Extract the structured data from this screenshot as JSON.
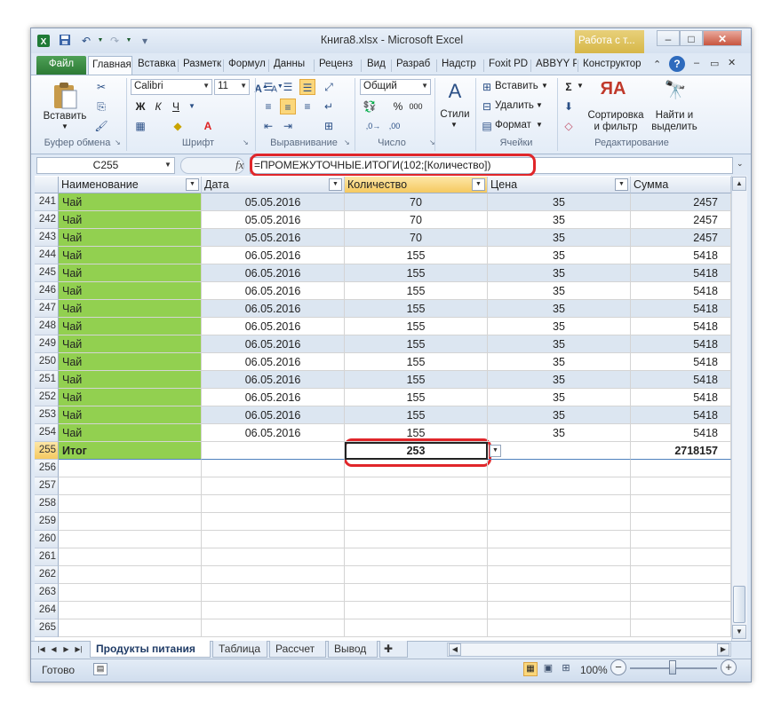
{
  "titlebar": {
    "title": "Книга8.xlsx - Microsoft Excel",
    "context_tab": "Работа с т...",
    "qat": [
      "excel-icon",
      "save-icon",
      "undo-icon",
      "redo-icon"
    ]
  },
  "ribbon_tabs": [
    {
      "label": "Файл",
      "kind": "file"
    },
    {
      "label": "Главная",
      "kind": "active"
    },
    {
      "label": "Вставка"
    },
    {
      "label": "Разметк"
    },
    {
      "label": "Формул"
    },
    {
      "label": "Данны"
    },
    {
      "label": "Реценз"
    },
    {
      "label": "Вид"
    },
    {
      "label": "Разраб"
    },
    {
      "label": "Надстр"
    },
    {
      "label": "Foxit PD"
    },
    {
      "label": "ABBYY P"
    },
    {
      "label": "Конструктор"
    }
  ],
  "ribbon": {
    "clipboard": {
      "paste": "Вставить",
      "group": "Буфер обмена"
    },
    "font": {
      "name": "Calibri",
      "size": "11",
      "bold": "Ж",
      "italic": "К",
      "underline": "Ч",
      "group": "Шрифт"
    },
    "alignment": {
      "group": "Выравнивание"
    },
    "number": {
      "format": "Общий",
      "percent": "%",
      "thousands": "000",
      "group": "Число"
    },
    "styles": {
      "label": "Стили"
    },
    "cells": {
      "insert": "Вставить",
      "delete": "Удалить",
      "format": "Формат",
      "group": "Ячейки"
    },
    "editing": {
      "sigma": "Σ",
      "sort_line1": "Сортировка",
      "sort_line2": "и фильтр",
      "find_line1": "Найти и",
      "find_line2": "выделить",
      "group": "Редактирование"
    }
  },
  "formula_bar": {
    "name_box": "C255",
    "fx": "fx",
    "formula": "=ПРОМЕЖУТОЧНЫЕ.ИТОГИ(102;[Количество])"
  },
  "columns": [
    "Наименование",
    "Дата",
    "Количество",
    "Цена",
    "Сумма"
  ],
  "rows": [
    {
      "num": "241",
      "name": "Чай",
      "date": "05.05.2016",
      "qty": "70",
      "price": "35",
      "sum": "2457"
    },
    {
      "num": "242",
      "name": "Чай",
      "date": "05.05.2016",
      "qty": "70",
      "price": "35",
      "sum": "2457"
    },
    {
      "num": "243",
      "name": "Чай",
      "date": "05.05.2016",
      "qty": "70",
      "price": "35",
      "sum": "2457"
    },
    {
      "num": "244",
      "name": "Чай",
      "date": "06.05.2016",
      "qty": "155",
      "price": "35",
      "sum": "5418"
    },
    {
      "num": "245",
      "name": "Чай",
      "date": "06.05.2016",
      "qty": "155",
      "price": "35",
      "sum": "5418"
    },
    {
      "num": "246",
      "name": "Чай",
      "date": "06.05.2016",
      "qty": "155",
      "price": "35",
      "sum": "5418"
    },
    {
      "num": "247",
      "name": "Чай",
      "date": "06.05.2016",
      "qty": "155",
      "price": "35",
      "sum": "5418"
    },
    {
      "num": "248",
      "name": "Чай",
      "date": "06.05.2016",
      "qty": "155",
      "price": "35",
      "sum": "5418"
    },
    {
      "num": "249",
      "name": "Чай",
      "date": "06.05.2016",
      "qty": "155",
      "price": "35",
      "sum": "5418"
    },
    {
      "num": "250",
      "name": "Чай",
      "date": "06.05.2016",
      "qty": "155",
      "price": "35",
      "sum": "5418"
    },
    {
      "num": "251",
      "name": "Чай",
      "date": "06.05.2016",
      "qty": "155",
      "price": "35",
      "sum": "5418"
    },
    {
      "num": "252",
      "name": "Чай",
      "date": "06.05.2016",
      "qty": "155",
      "price": "35",
      "sum": "5418"
    },
    {
      "num": "253",
      "name": "Чай",
      "date": "06.05.2016",
      "qty": "155",
      "price": "35",
      "sum": "5418"
    },
    {
      "num": "254",
      "name": "Чай",
      "date": "06.05.2016",
      "qty": "155",
      "price": "35",
      "sum": "5418"
    }
  ],
  "total_row": {
    "num": "255",
    "name": "Итог",
    "qty": "253",
    "sum": "2718157"
  },
  "empty_rows": [
    "256",
    "257",
    "258",
    "259",
    "260",
    "261",
    "262",
    "263",
    "264",
    "265"
  ],
  "sheet_tabs": [
    "Продукты питания",
    "Таблица",
    "Рассчет",
    "Вывод"
  ],
  "active_sheet": "Продукты питания",
  "status": {
    "ready": "Готово",
    "zoom": "100%",
    "minus": "−",
    "plus": "+"
  },
  "colors": {
    "green_cell": "#92d050",
    "band": "#dce6f1",
    "highlight": "#e0262a",
    "file_tab": "#2c7a35"
  }
}
